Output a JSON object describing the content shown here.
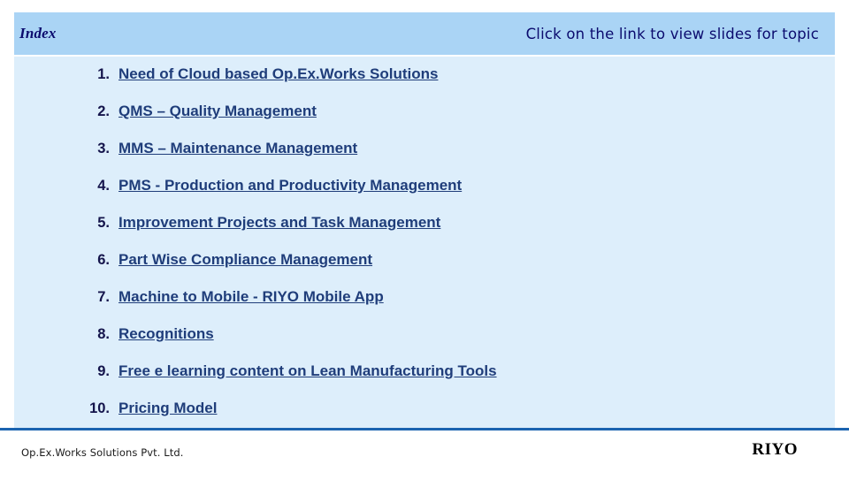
{
  "header": {
    "title": "Index",
    "note": "Click on the link to view slides for topic"
  },
  "index": {
    "items": [
      {
        "num": "1.",
        "label": "Need of Cloud based Op.Ex.Works Solutions"
      },
      {
        "num": "2.",
        "label": "QMS – Quality Management"
      },
      {
        "num": "3.",
        "label": "MMS – Maintenance Management"
      },
      {
        "num": "4.",
        "label": "PMS - Production and Productivity Management"
      },
      {
        "num": "5.",
        "label": "Improvement Projects and Task Management"
      },
      {
        "num": "6.",
        "label": "Part Wise Compliance Management"
      },
      {
        "num": "7.",
        "label": "Machine to Mobile - RIYO Mobile App"
      },
      {
        "num": "8.",
        "label": "Recognitions"
      },
      {
        "num": "9.",
        "label": "Free e learning content on Lean Manufacturing Tools"
      },
      {
        "num": "10.",
        "label": "Pricing Model"
      }
    ]
  },
  "footer": {
    "company": "Op.Ex.Works Solutions Pvt. Ltd.",
    "brand": "RIYO"
  },
  "colors": {
    "header_bg": "#aad4f5",
    "body_bg": "#ddeefb",
    "link": "#1f3d7a",
    "header_text": "#0b0b6e",
    "footer_rule": "#1b63b0"
  }
}
